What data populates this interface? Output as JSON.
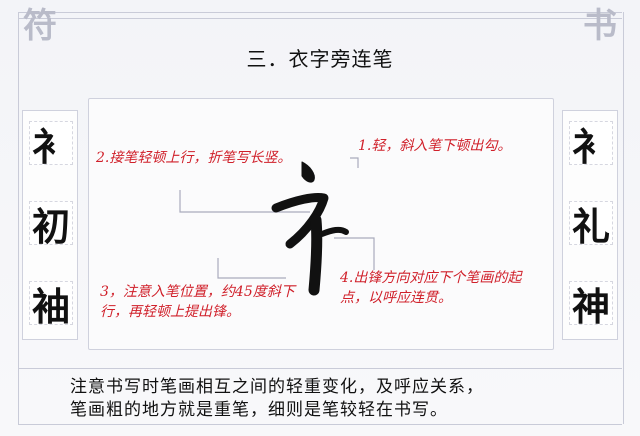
{
  "corners": {
    "top_left": "符",
    "top_right": "书"
  },
  "title": "三．衣字旁连笔",
  "left_column": [
    "衤",
    "初",
    "袖"
  ],
  "right_column": [
    "衤",
    "礼",
    "神"
  ],
  "notes": {
    "n1": "1.轻，斜入笔下顿出勾。",
    "n2": "2.接笔轻顿上行，折笔写长竖。",
    "n3": "3，注意入笔位置，约45度斜下行，再轻顿上提出锋。",
    "n4": "4.出锋方向对应下个笔画的起点，以呼应连贯。"
  },
  "bottom_text": {
    "line1": "注意书写时笔画相互之间的轻重变化，及呼应关系，",
    "line2": "笔画粗的地方就是重笔，细则是笔较轻在书写。"
  },
  "colors": {
    "note": "#d0202a",
    "line": "#a9abbd",
    "ink": "#111111"
  }
}
